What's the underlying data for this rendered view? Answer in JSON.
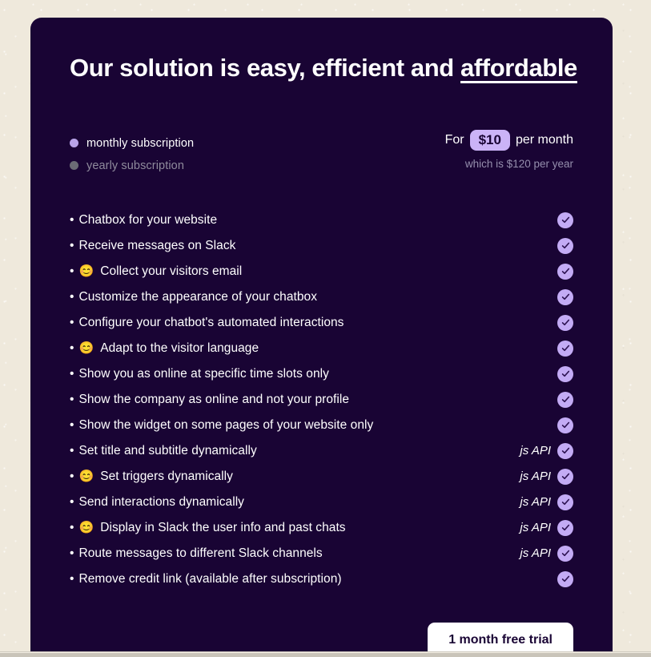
{
  "headline": {
    "text_before": "Our solution is easy, efficient and ",
    "underlined": "affordable"
  },
  "plan": {
    "options": [
      {
        "label": "monthly subscription",
        "selected": true
      },
      {
        "label": "yearly subscription",
        "selected": false
      }
    ],
    "price_prefix": "For",
    "price_amount": "$10",
    "price_suffix": "per month",
    "price_note": "which is $120 per year"
  },
  "features": [
    {
      "bullet": "•",
      "emoji": "",
      "text": "Chatbox for your website",
      "api": "",
      "checked": true
    },
    {
      "bullet": "•",
      "emoji": "",
      "text": "Receive messages on Slack",
      "api": "",
      "checked": true
    },
    {
      "bullet": "•",
      "emoji": "😊",
      "text": "Collect your visitors email",
      "api": "",
      "checked": true
    },
    {
      "bullet": "•",
      "emoji": "",
      "text": "Customize the appearance of your chatbox",
      "api": "",
      "checked": true
    },
    {
      "bullet": "•",
      "emoji": "",
      "text": "Configure your chatbot's automated interactions",
      "api": "",
      "checked": true
    },
    {
      "bullet": "•",
      "emoji": "😊",
      "text": "Adapt to the visitor language",
      "api": "",
      "checked": true
    },
    {
      "bullet": "•",
      "emoji": "",
      "text": "Show you as online at specific time slots only",
      "api": "",
      "checked": true
    },
    {
      "bullet": "•",
      "emoji": "",
      "text": "Show the company as online and not your profile",
      "api": "",
      "checked": true
    },
    {
      "bullet": "•",
      "emoji": "",
      "text": "Show the widget on some pages of your website only",
      "api": "",
      "checked": true
    },
    {
      "bullet": "•",
      "emoji": "",
      "text": "Set title and subtitle dynamically",
      "api": "js API",
      "checked": true
    },
    {
      "bullet": "•",
      "emoji": "😊",
      "text": "Set triggers dynamically",
      "api": "js API",
      "checked": true
    },
    {
      "bullet": "•",
      "emoji": "",
      "text": "Send interactions dynamically",
      "api": "js API",
      "checked": true
    },
    {
      "bullet": "•",
      "emoji": "😊",
      "text": "Display in Slack the user info and past chats",
      "api": "js API",
      "checked": true
    },
    {
      "bullet": "•",
      "emoji": "",
      "text": "Route messages to different Slack channels",
      "api": "js API",
      "checked": true
    },
    {
      "bullet": "•",
      "emoji": "",
      "text": "Remove credit link (available after subscription)",
      "api": "",
      "checked": true
    }
  ],
  "cta": {
    "label": "1 month free trial"
  },
  "colors": {
    "page_background": "#efe9dc",
    "card_background": "#190434",
    "accent_light_purple": "#c3abf5",
    "price_pill": "#cbb3f7",
    "radio_selected": "#b9a4e8",
    "radio_unselected": "#6b6b75",
    "muted_text": "#958fad",
    "cta_background": "#ffffff"
  }
}
